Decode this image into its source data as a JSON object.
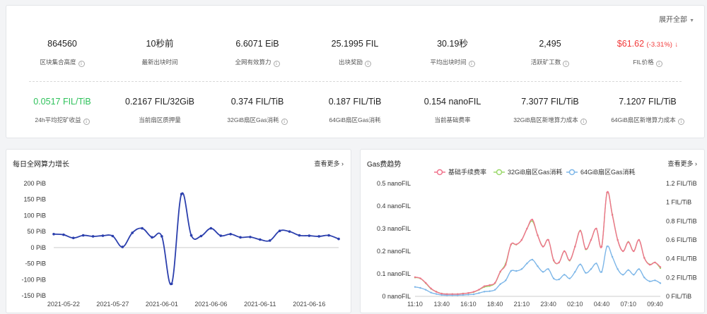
{
  "header": {
    "expand_all": "展开全部"
  },
  "stats_row1": [
    {
      "value": "864560",
      "label": "区块集合高度",
      "info": true
    },
    {
      "value": "10秒前",
      "label": "最新出块时间",
      "info": false
    },
    {
      "value": "6.6071 EiB",
      "label": "全网有效算力",
      "info": true
    },
    {
      "value": "25.1995 FIL",
      "label": "出块奖励",
      "info": true
    },
    {
      "value": "30.19秒",
      "label": "平均出块时间",
      "info": true
    },
    {
      "value": "2,495",
      "label": "活跃矿工数",
      "info": true
    },
    {
      "value": "$61.62",
      "change": "(-3.31%)",
      "arrow": "↓",
      "label": "FIL价格",
      "info": true,
      "color": "red"
    }
  ],
  "stats_row2": [
    {
      "value": "0.0517 FIL/TiB",
      "label": "24h平均挖矿收益",
      "info": true,
      "color": "green"
    },
    {
      "value": "0.2167 FIL/32GiB",
      "label": "当前扇区质押量",
      "info": false
    },
    {
      "value": "0.374 FIL/TiB",
      "label": "32GiB扇区Gas消耗",
      "info": true
    },
    {
      "value": "0.187 FIL/TiB",
      "label": "64GiB扇区Gas消耗",
      "info": false
    },
    {
      "value": "0.154 nanoFIL",
      "label": "当前基础费率",
      "info": false
    },
    {
      "value": "7.3077 FIL/TiB",
      "label": "32GiB扇区新增算力成本",
      "info": true
    },
    {
      "value": "7.1207 FIL/TiB",
      "label": "64GiB扇区新增算力成本",
      "info": true
    }
  ],
  "power_panel": {
    "title": "每日全网算力增长",
    "more": "查看更多 ›"
  },
  "gas_panel": {
    "title": "Gas费趋势",
    "more": "查看更多 ›"
  },
  "colors": {
    "green": "#2fc25b",
    "red": "#f23a3a",
    "power_line": "#2b3fad",
    "base_fee": "#f0738c",
    "gas32": "#9bd96b",
    "gas64": "#7cb6e8"
  },
  "chart_data": [
    {
      "type": "line",
      "title": "每日全网算力增长",
      "ylabel_unit": "PiB",
      "ylim": [
        -150,
        200
      ],
      "yticks": [
        "200 PiB",
        "150 PiB",
        "100 PiB",
        "50 PiB",
        "0 PiB",
        "-50 PiB",
        "-100 PiB",
        "-150 PiB"
      ],
      "ytick_values": [
        200,
        150,
        100,
        50,
        0,
        -50,
        -100,
        -150
      ],
      "x_tick_labels": [
        "2021-05-22",
        "2021-05-27",
        "2021-06-01",
        "2021-06-06",
        "2021-06-11",
        "2021-06-16"
      ],
      "x_tick_indices": [
        1,
        6,
        11,
        16,
        21,
        26
      ],
      "x": [
        "2021-05-21",
        "2021-05-22",
        "2021-05-23",
        "2021-05-24",
        "2021-05-25",
        "2021-05-26",
        "2021-05-27",
        "2021-05-28",
        "2021-05-29",
        "2021-05-30",
        "2021-05-31",
        "2021-06-01",
        "2021-06-02",
        "2021-06-03",
        "2021-06-04",
        "2021-06-05",
        "2021-06-06",
        "2021-06-07",
        "2021-06-08",
        "2021-06-09",
        "2021-06-10",
        "2021-06-11",
        "2021-06-12",
        "2021-06-13",
        "2021-06-14",
        "2021-06-15",
        "2021-06-16",
        "2021-06-17",
        "2021-06-18",
        "2021-06-19",
        "2021-06-20",
        "2021-06-21",
        "2021-06-22"
      ],
      "series": [
        {
          "values": [
            42,
            40,
            30,
            38,
            35,
            37,
            36,
            2,
            46,
            60,
            32,
            35,
            -113,
            167,
            38,
            36,
            60,
            37,
            42,
            32,
            33,
            25,
            22,
            52,
            50,
            38,
            37,
            35,
            38,
            27
          ]
        }
      ],
      "grid": false
    },
    {
      "type": "line",
      "title": "Gas费趋势",
      "legend": [
        "基础手续费率",
        "32GiB扇区Gas消耗",
        "64GiB扇区Gas消耗"
      ],
      "legend_position": "top",
      "left_axis": {
        "ticks": [
          "0.5 nanoFIL",
          "0.4 nanoFIL",
          "0.3 nanoFIL",
          "0.2 nanoFIL",
          "0.1 nanoFIL",
          "0 nanoFIL"
        ],
        "values": [
          0.5,
          0.4,
          0.3,
          0.2,
          0.1,
          0
        ],
        "ylim": [
          0,
          0.5
        ]
      },
      "right_axis": {
        "ticks": [
          "1.2 FIL/TiB",
          "1 FIL/TiB",
          "0.8 FIL/TiB",
          "0.6 FIL/TiB",
          "0.4 FIL/TiB",
          "0.2 FIL/TiB",
          "0 FIL/TiB"
        ],
        "values": [
          1.2,
          1.0,
          0.8,
          0.6,
          0.4,
          0.2,
          0
        ],
        "ylim": [
          0,
          1.2
        ]
      },
      "x_tick_labels": [
        "11:10",
        "13:40",
        "16:10",
        "18:40",
        "21:10",
        "23:40",
        "02:10",
        "04:40",
        "07:10",
        "09:40"
      ],
      "x_tick_indices": [
        0,
        5,
        10,
        15,
        20,
        25,
        30,
        35,
        40,
        45
      ],
      "series": [
        {
          "name": "基础手续费率",
          "axis": "left",
          "values": [
            0.085,
            0.08,
            0.06,
            0.035,
            0.02,
            0.012,
            0.01,
            0.01,
            0.01,
            0.012,
            0.015,
            0.02,
            0.03,
            0.045,
            0.05,
            0.06,
            0.11,
            0.14,
            0.23,
            0.23,
            0.25,
            0.3,
            0.34,
            0.27,
            0.22,
            0.25,
            0.16,
            0.15,
            0.2,
            0.16,
            0.22,
            0.29,
            0.21,
            0.25,
            0.3,
            0.22,
            0.46,
            0.36,
            0.25,
            0.2,
            0.24,
            0.2,
            0.25,
            0.17,
            0.14,
            0.15,
            0.13
          ]
        },
        {
          "name": "32GiB扇区Gas消耗",
          "axis": "right",
          "values": [
            0.2,
            0.19,
            0.14,
            0.08,
            0.05,
            0.03,
            0.025,
            0.025,
            0.025,
            0.03,
            0.035,
            0.045,
            0.07,
            0.1,
            0.11,
            0.14,
            0.26,
            0.35,
            0.55,
            0.55,
            0.6,
            0.72,
            0.8,
            0.65,
            0.53,
            0.6,
            0.38,
            0.36,
            0.48,
            0.38,
            0.53,
            0.7,
            0.5,
            0.6,
            0.72,
            0.53,
            1.1,
            0.87,
            0.6,
            0.48,
            0.58,
            0.48,
            0.6,
            0.41,
            0.34,
            0.36,
            0.3
          ]
        },
        {
          "name": "64GiB扇区Gas消耗",
          "axis": "right",
          "values": [
            0.1,
            0.09,
            0.07,
            0.04,
            0.025,
            0.015,
            0.012,
            0.012,
            0.012,
            0.015,
            0.018,
            0.022,
            0.035,
            0.05,
            0.055,
            0.07,
            0.13,
            0.17,
            0.27,
            0.27,
            0.29,
            0.35,
            0.39,
            0.32,
            0.26,
            0.29,
            0.19,
            0.18,
            0.23,
            0.19,
            0.26,
            0.34,
            0.25,
            0.29,
            0.35,
            0.26,
            0.53,
            0.42,
            0.29,
            0.23,
            0.28,
            0.23,
            0.29,
            0.2,
            0.16,
            0.17,
            0.14
          ]
        }
      ],
      "grid": false
    }
  ]
}
